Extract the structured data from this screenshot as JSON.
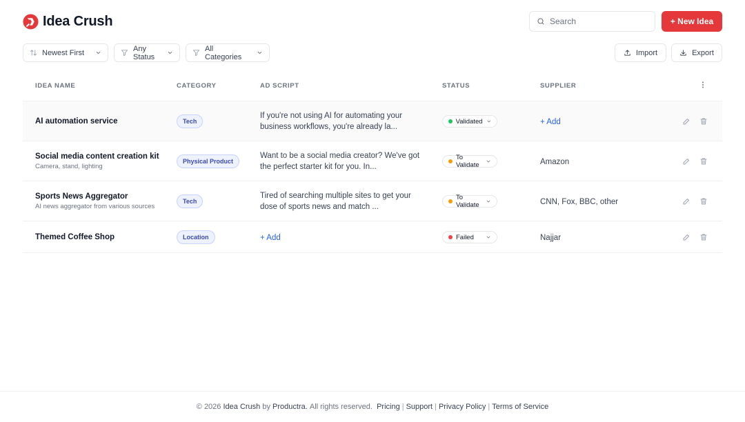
{
  "app": {
    "name": "Idea Crush",
    "brand_color": "#e5383b"
  },
  "header": {
    "search_placeholder": "Search",
    "new_button": "+ New Idea"
  },
  "toolbar": {
    "sort": "Newest First",
    "status_filter": "Any Status",
    "category_filter": "All Categories",
    "import": "Import",
    "export": "Export"
  },
  "table": {
    "columns": [
      "Idea Name",
      "Category",
      "Ad Script",
      "Status",
      "Supplier"
    ],
    "rows": [
      {
        "name": "AI automation service",
        "sub": "",
        "category": "Tech",
        "ad": "If you're not using AI for automating your business workflows, you're already la...",
        "ad_add": "",
        "status": "Validated",
        "status_color": "#22c55e",
        "supplier": "",
        "supplier_add": "+ Add"
      },
      {
        "name": "Social media content creation kit",
        "sub": "Camera, stand, lighting",
        "category": "Physical Product",
        "ad": "Want to be a social media creator? We've got the perfect starter kit for you. In...",
        "ad_add": "",
        "status": "To Validate",
        "status_color": "#f59e0b",
        "supplier": "Amazon",
        "supplier_add": ""
      },
      {
        "name": "Sports News Aggregator",
        "sub": "AI news aggregator from various sources",
        "category": "Tech",
        "ad": "Tired of searching multiple sites to get your dose of sports news and match ...",
        "ad_add": "",
        "status": "To Validate",
        "status_color": "#f59e0b",
        "supplier": "CNN, Fox, BBC, other",
        "supplier_add": ""
      },
      {
        "name": "Themed Coffee Shop",
        "sub": "",
        "category": "Location",
        "ad": "",
        "ad_add": "+ Add",
        "status": "Failed",
        "status_color": "#ef4444",
        "supplier": "Najjar",
        "supplier_add": ""
      }
    ]
  },
  "footer": {
    "copyright": "© 2026",
    "app_name": "Idea Crush",
    "by": "by",
    "company": "Productra.",
    "rights": "All rights reserved.",
    "links": [
      "Pricing",
      "Support",
      "Privacy Policy",
      "Terms of Service"
    ]
  }
}
